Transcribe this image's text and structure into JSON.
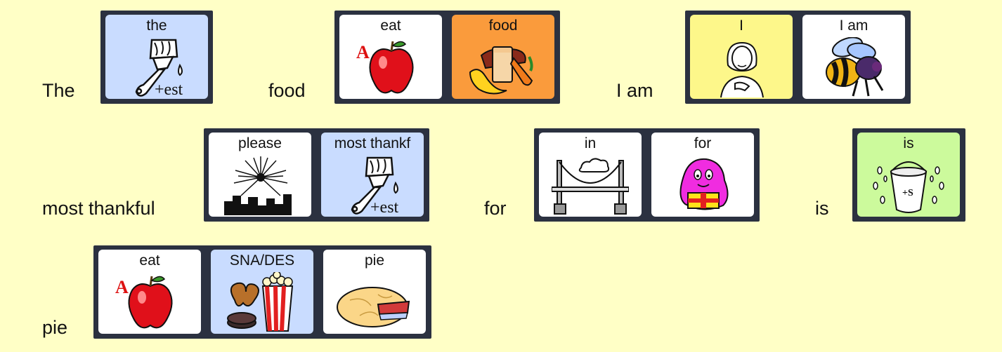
{
  "colors": {
    "background": "#ffffc6",
    "strip": "#2b3140",
    "card_white": "#ffffff",
    "card_blue": "#c9dcff",
    "card_orange": "#fa9b3c",
    "card_yellow": "#fdf78a",
    "card_green": "#ccfa9c"
  },
  "rows": [
    {
      "groups": [
        {
          "word": "The",
          "cards": [
            {
              "label": "the",
              "icon": "paintbrush-est-icon",
              "color": "#c9dcff"
            }
          ]
        },
        {
          "word": "food",
          "cards": [
            {
              "label": "eat",
              "icon": "apple-icon",
              "color": "#ffffff"
            },
            {
              "label": "food",
              "icon": "food-icon",
              "color": "#fa9b3c"
            }
          ]
        },
        {
          "word": "I am",
          "cards": [
            {
              "label": "I",
              "icon": "person-self-icon",
              "color": "#fdf78a"
            },
            {
              "label": "I am",
              "icon": "bee-icon",
              "color": "#ffffff"
            }
          ]
        }
      ]
    },
    {
      "groups": [
        {
          "word": "most thankful",
          "cards": [
            {
              "label": "please",
              "icon": "fireworks-icon",
              "color": "#ffffff"
            },
            {
              "label": "most thankf",
              "icon": "paintbrush-est-icon",
              "color": "#c9dcff"
            }
          ]
        },
        {
          "word": "for",
          "cards": [
            {
              "label": "in",
              "icon": "bridge-icon",
              "color": "#ffffff"
            },
            {
              "label": "for",
              "icon": "gift-monster-icon",
              "color": "#ffffff"
            }
          ]
        },
        {
          "word": "is",
          "cards": [
            {
              "label": "is",
              "icon": "bucket-s-icon",
              "color": "#ccfa9c"
            }
          ]
        }
      ]
    },
    {
      "groups": [
        {
          "word": "pie",
          "cards": [
            {
              "label": "eat",
              "icon": "apple-icon",
              "color": "#ffffff"
            },
            {
              "label": "SNA/DES",
              "icon": "snacks-icon",
              "color": "#c9dcff"
            },
            {
              "label": "pie",
              "icon": "pie-icon",
              "color": "#ffffff"
            }
          ]
        }
      ]
    }
  ],
  "icon_text": {
    "est": "+est",
    "s": "+S",
    "a": "A"
  }
}
